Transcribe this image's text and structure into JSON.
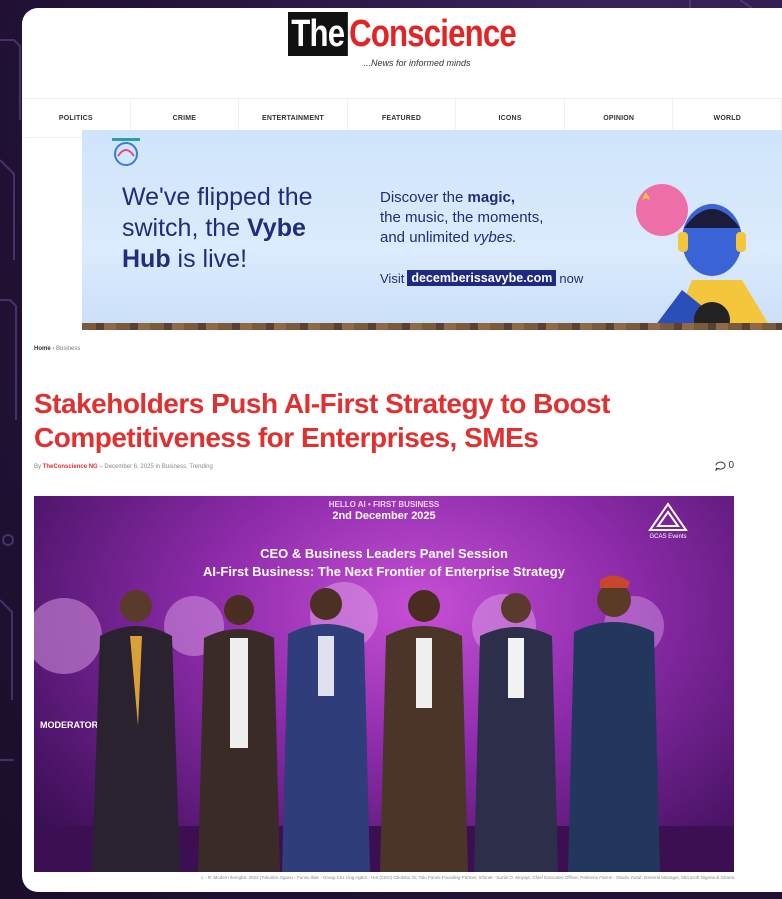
{
  "site": {
    "logo_the": "The",
    "logo_conscience": "Conscience",
    "tagline": "...News for informed minds"
  },
  "nav": {
    "items": [
      "POLITICS",
      "CRIME",
      "ENTERTAINMENT",
      "FEATURED",
      "ICONS",
      "OPINION",
      "WORLD"
    ]
  },
  "banner": {
    "headline_1": "We've flipped the switch, the ",
    "headline_bold_1": "Vybe",
    "headline_bold_2": "Hub",
    "headline_2": " is live!",
    "body_1": "Discover the ",
    "body_magic": "magic,",
    "body_2": "the music, the moments,",
    "body_3": "and unlimited ",
    "body_vybes": "vybes.",
    "visit_label": "Visit",
    "url": "decemberissavybe.com",
    "visit_suffix": "now",
    "colors": {
      "navy": "#1f2d7a",
      "url_bg": "#1e2a82",
      "sky": "#cfe4fb"
    }
  },
  "article": {
    "breadcrumb_home": "Home",
    "breadcrumb_section": "Business",
    "headline": "Stakeholders Push AI-First Strategy to Boost Competitiveness for Enterprises, SMEs",
    "meta_by": "By",
    "author": "TheConscience NG",
    "date": "December 6, 2025",
    "meta_in": "in",
    "categories": "Business, Trending",
    "comment_count": "0",
    "colors": {
      "headline": "#e03030"
    }
  },
  "photo": {
    "event_line": "HELLO AI • FIRST BUSINESS",
    "date_line": "2nd December 2025",
    "panel_title": "CEO & Business Leaders Panel Session",
    "panel_subtitle": "AI-First Business: The Next Frontier of Enterprise Strategy",
    "backdrop_text": "MODERATOR",
    "event_logo_text": "GCAS Events",
    "caption": "L - R: Modern Ikengba: 2023 (Tokunbo Ogunu - Funso Ilale - Group CiU Ling Agbor - HoI (CEO) Gbolohu Oi; Tolu Funmi Founding Partner, Infonet - Kunle O. Moyoje, Chief Executive Officer, Palmeria Farms - Olaolu Yusuf, General Manager, Microsoft Nigeria & Ghana"
  }
}
